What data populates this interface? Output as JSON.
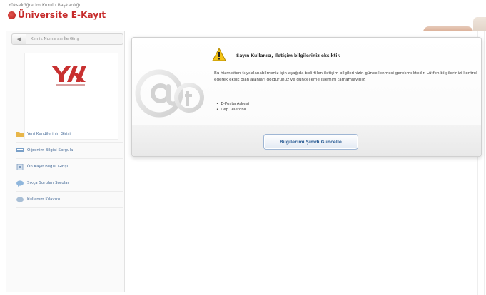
{
  "header": {
    "subtitle": "Yükseköğretim Kurulu Başkanlığı",
    "brand": "Üniversite E-Kayıt",
    "logo_icon": "university-logo-icon"
  },
  "sidebar": {
    "search_placeholder": "Kimlik Numarası İle Giriş",
    "search_icon": "back-arrow-icon",
    "logo_name": "yok-logo",
    "items": [
      {
        "label": "Yeni Kendilerinin Girişi",
        "icon": "folder-icon"
      },
      {
        "label": "Öğrenim Bilgisi Sorgula",
        "icon": "certificate-icon"
      },
      {
        "label": "Ön Kayıt Bilgisi Girişi",
        "icon": "document-icon"
      },
      {
        "label": "Sıkça Sorulan Sorular",
        "icon": "chat-icon"
      },
      {
        "label": "Kullanım Kılavuzu",
        "icon": "help-icon"
      }
    ]
  },
  "dialog": {
    "title": "Sayın Kullanıcı, İletişim bilgileriniz eksiktir.",
    "text": "Bu hizmetten faydalanabilmeniz için aşağıda belirtilen iletişim bilgilerinizin güncellenmesi gerekmektedir. Lütfen bilgilerinizi kontrol ederek eksik olan alanları doldurunuz ve güncelleme işlemini tamamlayınız.",
    "list": [
      "E-Posta Adresi",
      "Cep Telefonu"
    ],
    "button_label": "Bilgilerimi Şimdi Güncelle",
    "warning_icon": "warning-icon",
    "graphic_icon": "at-sign-icon"
  },
  "colors": {
    "brand": "#c62a2a",
    "link": "#4a6e9a",
    "button_text": "#3c6a9e"
  }
}
